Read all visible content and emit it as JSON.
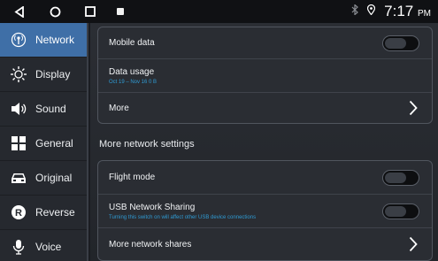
{
  "status_bar": {
    "time": "7:17",
    "time_suffix": "PM",
    "icons": [
      "back-icon",
      "home-icon",
      "recent-apps-icon",
      "notification-icon",
      "bluetooth-icon",
      "location-icon"
    ]
  },
  "sidebar": {
    "items": [
      {
        "label": "Network",
        "icon": "network-icon",
        "active": true
      },
      {
        "label": "Display",
        "icon": "display-icon",
        "active": false
      },
      {
        "label": "Sound",
        "icon": "sound-icon",
        "active": false
      },
      {
        "label": "General",
        "icon": "general-icon",
        "active": false
      },
      {
        "label": "Original",
        "icon": "original-icon",
        "active": false
      },
      {
        "label": "Reverse",
        "icon": "reverse-icon",
        "active": false
      },
      {
        "label": "Voice",
        "icon": "voice-icon",
        "active": false
      }
    ]
  },
  "main": {
    "card1": {
      "mobile_data": {
        "label": "Mobile data",
        "enabled": false
      },
      "data_usage": {
        "label": "Data usage",
        "subtitle": "Oct 19 – Nov 16 0 B"
      },
      "more": {
        "label": "More"
      }
    },
    "section_title": "More network settings",
    "card2": {
      "flight_mode": {
        "label": "Flight mode",
        "enabled": false
      },
      "usb_sharing": {
        "label": "USB Network Sharing",
        "subtitle": "Turning this switch on will affect other USB device connections",
        "enabled": false
      },
      "more_shares": {
        "label": "More network shares"
      }
    }
  },
  "colors": {
    "accent_active": "#3f6fa7",
    "subtitle_blue": "#2f9bd4"
  }
}
